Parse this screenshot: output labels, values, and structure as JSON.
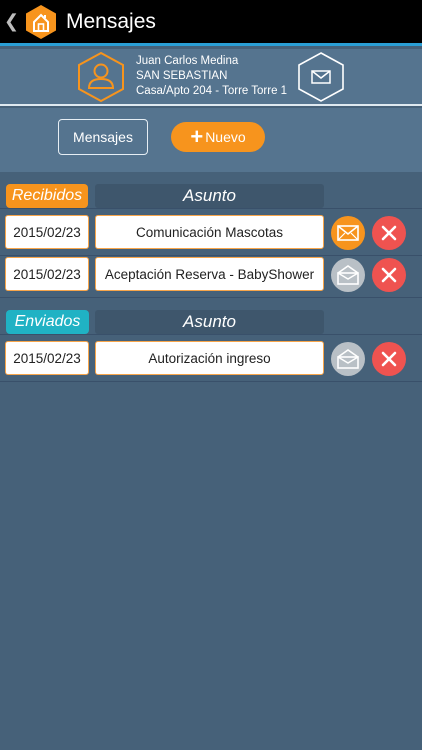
{
  "app": {
    "title": "Mensajes"
  },
  "profile": {
    "name": "Juan Carlos Medina",
    "community": "SAN SEBASTIAN",
    "unit": "Casa/Apto 204 - Torre Torre 1"
  },
  "nav": {
    "messages_tab": "Mensajes",
    "new_button": "Nuevo"
  },
  "received": {
    "label": "Recibidos",
    "subject_header": "Asunto",
    "rows": [
      {
        "date": "2015/02/23",
        "subject": "Comunicación Mascotas",
        "status": "unread"
      },
      {
        "date": "2015/02/23",
        "subject": "Aceptación Reserva - BabyShower",
        "status": "read"
      }
    ]
  },
  "sent": {
    "label": "Enviados",
    "subject_header": "Asunto",
    "rows": [
      {
        "date": "2015/02/23",
        "subject": "Autorización ingreso",
        "status": "read"
      }
    ]
  },
  "colors": {
    "background": "#466179",
    "accent_orange": "#f7941d",
    "accent_teal": "#20b2c4",
    "delete_red": "#ef5350",
    "read_gray": "#b9c0c6"
  },
  "icons": {
    "back": "chevron-left-icon",
    "logo": "house-hexagon-icon",
    "avatar": "user-icon",
    "profile_mail": "envelope-icon",
    "unread": "envelope-closed-icon",
    "read": "envelope-open-icon",
    "delete": "close-icon"
  }
}
